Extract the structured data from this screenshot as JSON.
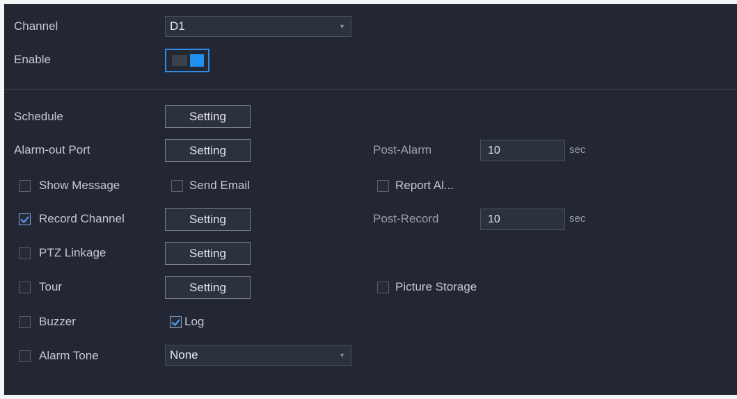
{
  "channel": {
    "label": "Channel",
    "value": "D1"
  },
  "enable": {
    "label": "Enable",
    "on": true
  },
  "schedule": {
    "label": "Schedule",
    "button": "Setting"
  },
  "alarm_out": {
    "label": "Alarm-out Port",
    "button": "Setting"
  },
  "post_alarm": {
    "label": "Post-Alarm",
    "value": "10",
    "unit": "sec"
  },
  "show_message": {
    "label": "Show Message",
    "checked": false
  },
  "send_email": {
    "label": "Send Email",
    "checked": false
  },
  "report_alarm": {
    "label": "Report Al...",
    "checked": false
  },
  "record_channel": {
    "label": "Record Channel",
    "checked": true,
    "button": "Setting"
  },
  "post_record": {
    "label": "Post-Record",
    "value": "10",
    "unit": "sec"
  },
  "ptz_linkage": {
    "label": "PTZ Linkage",
    "checked": false,
    "button": "Setting"
  },
  "tour": {
    "label": "Tour",
    "checked": false,
    "button": "Setting"
  },
  "picture_storage": {
    "label": "Picture Storage",
    "checked": false
  },
  "buzzer": {
    "label": "Buzzer",
    "checked": false
  },
  "log": {
    "label": "Log",
    "checked": true
  },
  "alarm_tone": {
    "label": "Alarm Tone",
    "checked": false,
    "value": "None"
  },
  "colors": {
    "panel_bg": "#222733",
    "accent": "#1f8ff0"
  }
}
